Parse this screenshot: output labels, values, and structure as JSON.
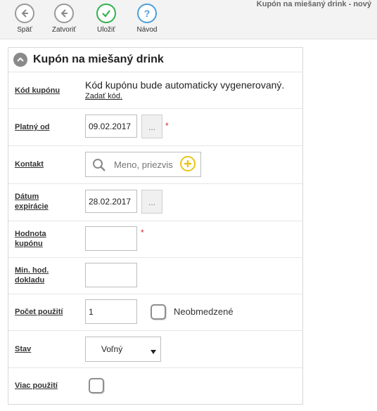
{
  "window_title": "Kupón na miešaný drink - nový",
  "toolbar": {
    "back": "Späť",
    "close": "Zatvoriť",
    "save": "Uložiť",
    "help": "Návod"
  },
  "panel": {
    "title": "Kupón na miešaný drink"
  },
  "form": {
    "coupon_code": {
      "label": "Kód kupónu",
      "info": "Kód kupónu bude automaticky vygenerovaný.",
      "link": "Zadať kód."
    },
    "valid_from": {
      "label": "Platný od",
      "value": "09.02.2017",
      "picker": "...",
      "required": "*"
    },
    "contact": {
      "label": "Kontakt",
      "placeholder": "Meno, priezvis"
    },
    "expiry": {
      "label_1": "Dátum",
      "label_2": "expirácie",
      "value": "28.02.2017",
      "picker": "..."
    },
    "value": {
      "label_1": "Hodnota",
      "label_2": "kupónu",
      "value": "",
      "required": "*"
    },
    "min_doc": {
      "label_1": "Min. hod.",
      "label_2": "dokladu",
      "value": ""
    },
    "usage_count": {
      "label": "Počet použití",
      "value": "1",
      "unlimited_label": "Neobmedzené",
      "unlimited_checked": false
    },
    "status": {
      "label": "Stav",
      "selected": "Voľný"
    },
    "multi_use": {
      "label": "Viac použití",
      "checked": false
    }
  },
  "colors": {
    "save_green": "#2fb24c",
    "help_blue": "#4d9fd9",
    "add_yellow": "#e8c51b",
    "required_red": "#d62b2b"
  }
}
